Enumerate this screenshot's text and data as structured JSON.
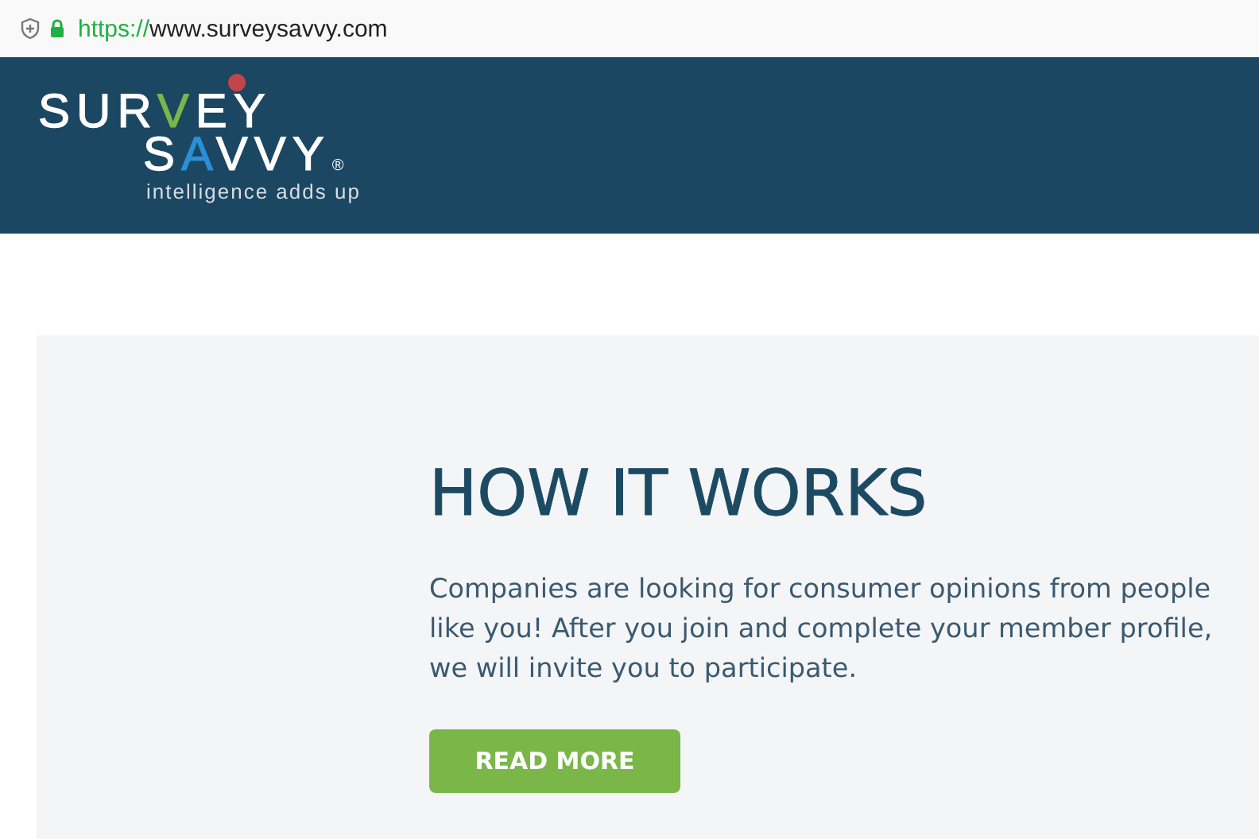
{
  "address_bar": {
    "scheme": "https://",
    "host": "www.surveysavvy.com",
    "secure": true
  },
  "logo": {
    "line_1": "SURVEY",
    "line_2": "SAVVY",
    "registered": "®",
    "tagline": "intelligence adds up"
  },
  "section": {
    "title": "HOW IT WORKS",
    "text": "Companies are looking for consumer opinions from people like you! After you join and complete your member profile, we will invite you to participate.",
    "button": "READ MORE"
  }
}
